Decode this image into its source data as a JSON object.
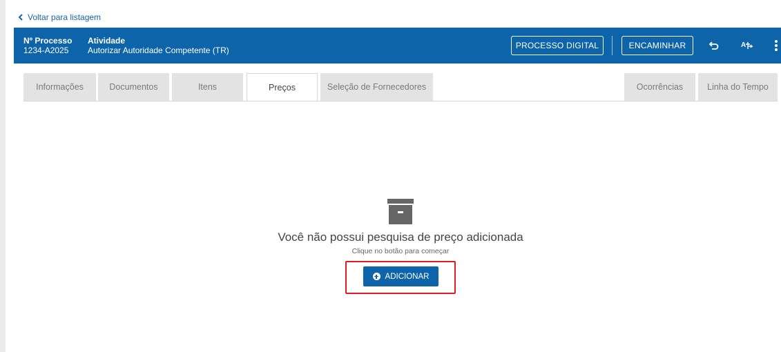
{
  "breadcrumb": {
    "back_label": "Voltar para listagem"
  },
  "header": {
    "processo_label": "Nº Processo",
    "processo_value": "1234-A2025",
    "atividade_label": "Atividade",
    "atividade_value": "Autorizar Autoridade Competente (TR)",
    "btn_processo_digital": "PROCESSO DIGITAL",
    "btn_encaminhar": "ENCAMINHAR",
    "icons": [
      "undo-icon",
      "translate-icon",
      "more-vertical-icon"
    ]
  },
  "tabs": [
    {
      "label": "Informações",
      "active": false
    },
    {
      "label": "Documentos",
      "active": false
    },
    {
      "label": "Itens",
      "active": false
    },
    {
      "label": "Preços",
      "active": true
    },
    {
      "label": "Seleção de Fornecedores",
      "active": false
    },
    {
      "label": "Ocorrências",
      "active": false
    },
    {
      "label": "Linha do Tempo",
      "active": false
    }
  ],
  "empty_state": {
    "icon": "archive-box-icon",
    "title": "Você não possui pesquisa de preço adicionada",
    "subtitle": "Clique no botão para começar",
    "add_button_label": "ADICIONAR"
  },
  "colors": {
    "primary": "#0e64a8",
    "highlight": "#e11b22",
    "tab_inactive_bg": "#e3e3e3",
    "link": "#1565a9"
  }
}
